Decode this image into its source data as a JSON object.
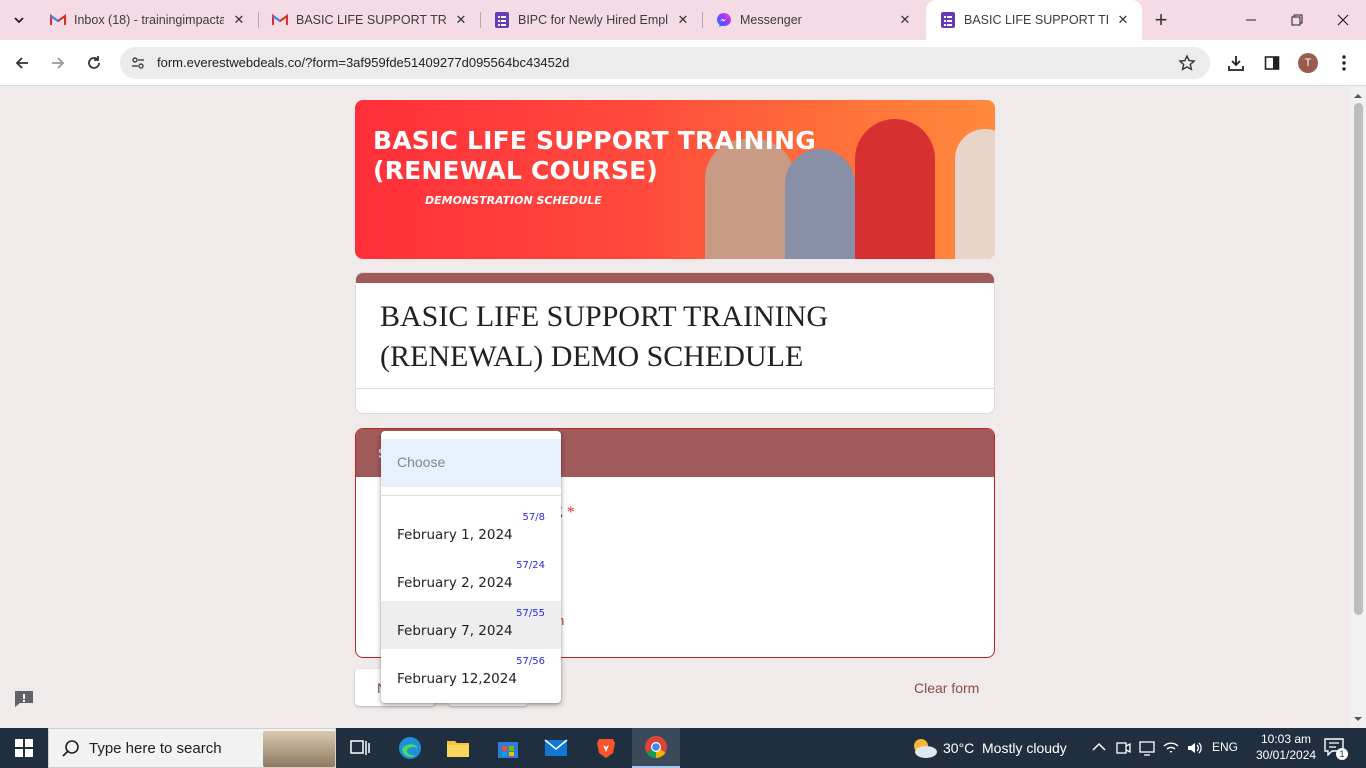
{
  "browser": {
    "tabs": [
      {
        "title": "Inbox (18) - trainingimpacta",
        "icon": "gmail-icon"
      },
      {
        "title": "BASIC LIFE SUPPORT TRAINI",
        "icon": "gmail-icon"
      },
      {
        "title": "BIPC for Newly Hired Employ",
        "icon": "forms-icon"
      },
      {
        "title": "Messenger",
        "icon": "messenger-icon"
      },
      {
        "title": "BASIC LIFE SUPPORT TRAINI",
        "icon": "forms-icon",
        "active": true
      }
    ],
    "url": "form.everestwebdeals.co/?form=3af959fde51409277d095564bc43452d",
    "profile_initial": "T"
  },
  "banner": {
    "line1": "BASIC LIFE SUPPORT TRAINING",
    "line2": "(RENEWAL COURSE)",
    "line3": "DEMONSTRATION SCHEDULE"
  },
  "form": {
    "title": "BASIC LIFE SUPPORT TRAINING (RENEWAL) DEMO SCHEDULE",
    "section_header": "S",
    "question_label_tail": "E",
    "required_marker": "*",
    "error_text": "n",
    "next_label": "N",
    "clear_label": "Clear form",
    "footnote": "N"
  },
  "dropdown": {
    "placeholder": "Choose",
    "options": [
      {
        "date": "February 1, 2024",
        "count": "57/8"
      },
      {
        "date": "February 2, 2024",
        "count": "57/24"
      },
      {
        "date": "February 7, 2024",
        "count": "57/55",
        "hovered": true
      },
      {
        "date": "February 12,2024",
        "count": "57/56"
      }
    ]
  },
  "taskbar": {
    "search_placeholder": "Type here to search",
    "weather_temp": "30°C",
    "weather_text": "Mostly cloudy",
    "language": "ENG",
    "time": "10:03 am",
    "date": "30/01/2024",
    "notification_count": "1"
  },
  "colors": {
    "form_accent": "#a05a5a",
    "error": "#d93025",
    "page_bg": "#f1eaea",
    "tabstrip_bg": "#f4dbe6"
  }
}
